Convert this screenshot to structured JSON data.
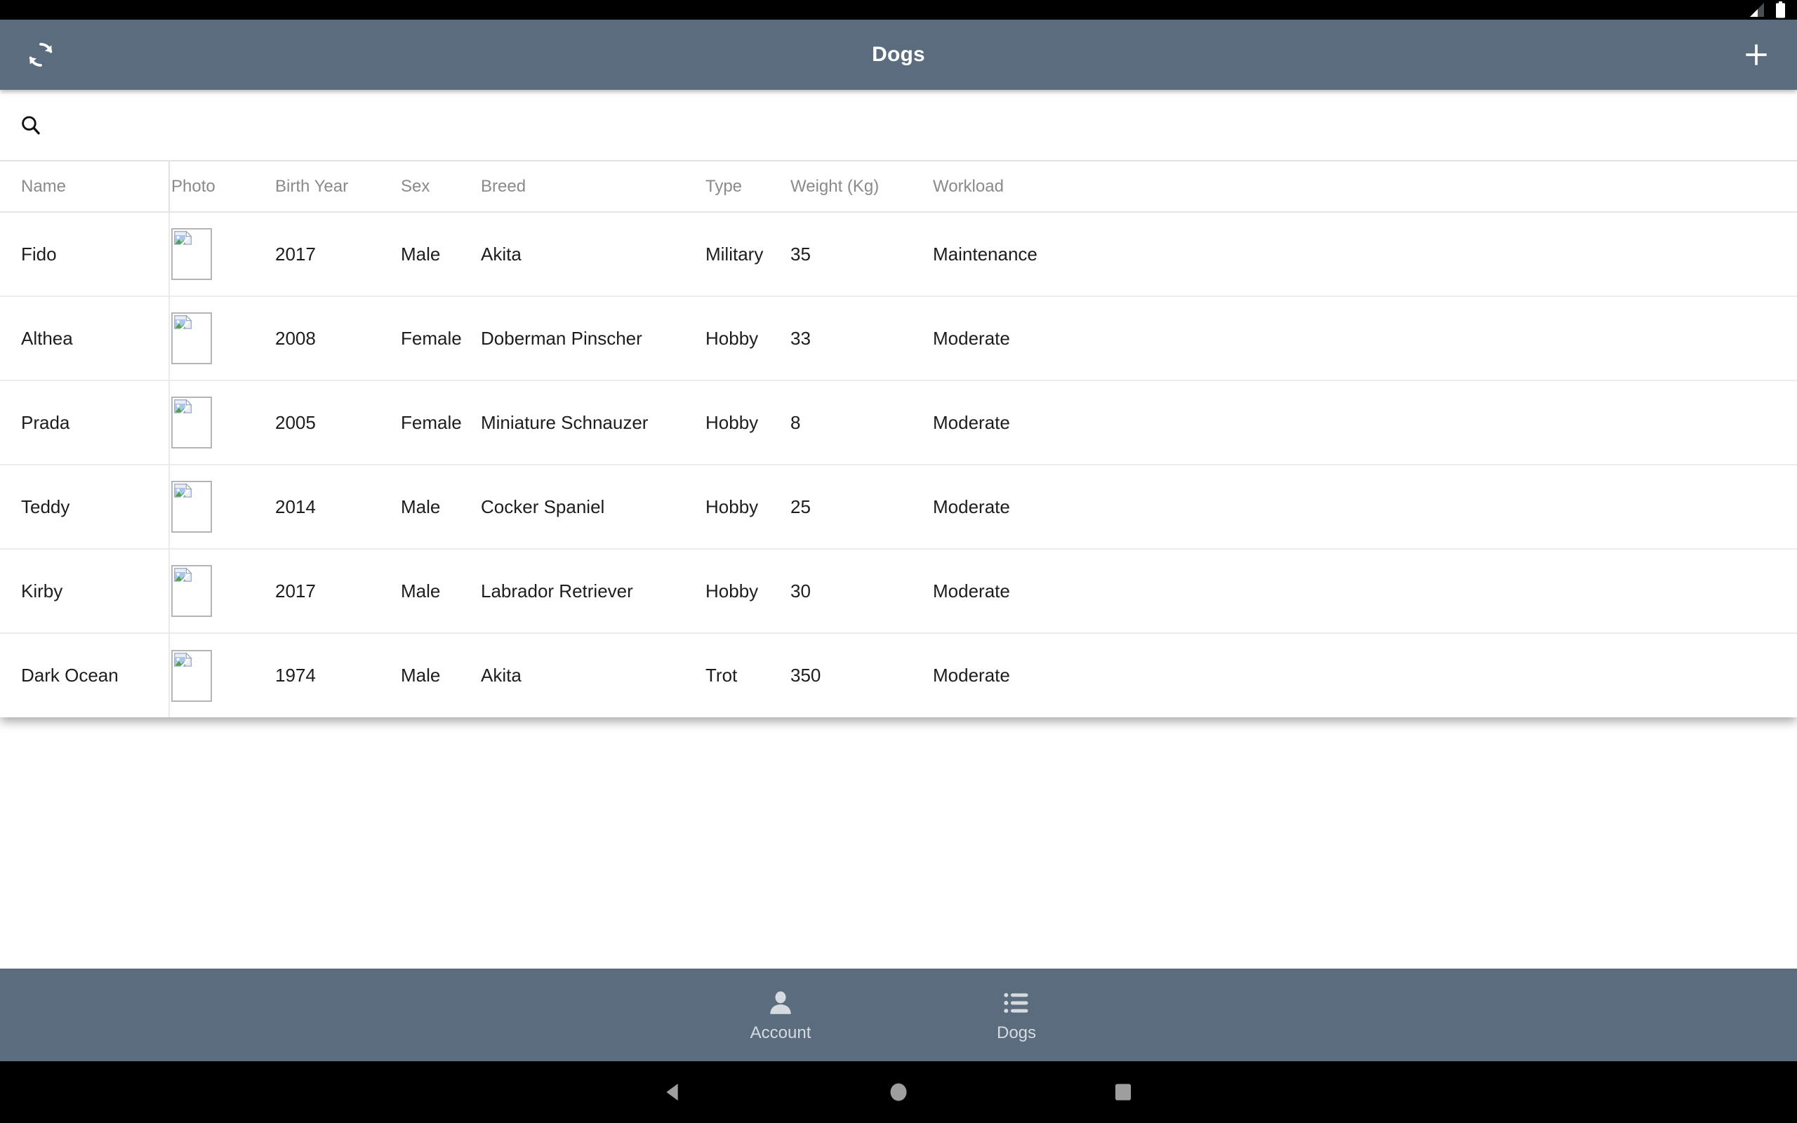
{
  "status_bar": {
    "signal_icon": "cell-signal-icon",
    "battery_icon": "battery-icon"
  },
  "app_bar": {
    "title": "Dogs",
    "refresh_icon": "refresh-icon",
    "add_icon": "plus-icon",
    "background_color": "#5b6c7e"
  },
  "search": {
    "icon": "search-icon",
    "value": "",
    "placeholder": ""
  },
  "table": {
    "columns": [
      {
        "key": "name",
        "label": "Name"
      },
      {
        "key": "photo",
        "label": "Photo"
      },
      {
        "key": "birth",
        "label": "Birth Year"
      },
      {
        "key": "sex",
        "label": "Sex"
      },
      {
        "key": "breed",
        "label": "Breed"
      },
      {
        "key": "type",
        "label": "Type"
      },
      {
        "key": "weight",
        "label": "Weight (Kg)"
      },
      {
        "key": "workload",
        "label": "Workload"
      }
    ],
    "photo_placeholder_icon": "broken-image-icon",
    "rows": [
      {
        "name": "Fido",
        "birth": "2017",
        "sex": "Male",
        "breed": "Akita",
        "type": "Military",
        "weight": "35",
        "workload": "Maintenance"
      },
      {
        "name": "Althea",
        "birth": "2008",
        "sex": "Female",
        "breed": "Doberman Pinscher",
        "type": "Hobby",
        "weight": "33",
        "workload": "Moderate"
      },
      {
        "name": "Prada",
        "birth": "2005",
        "sex": "Female",
        "breed": "Miniature Schnauzer",
        "type": "Hobby",
        "weight": "8",
        "workload": "Moderate"
      },
      {
        "name": "Teddy",
        "birth": "2014",
        "sex": "Male",
        "breed": "Cocker Spaniel",
        "type": "Hobby",
        "weight": "25",
        "workload": "Moderate"
      },
      {
        "name": "Kirby",
        "birth": "2017",
        "sex": "Male",
        "breed": "Labrador Retriever",
        "type": "Hobby",
        "weight": "30",
        "workload": "Moderate"
      },
      {
        "name": "Dark Ocean",
        "birth": "1974",
        "sex": "Male",
        "breed": "Akita",
        "type": "Trot",
        "weight": "350",
        "workload": "Moderate"
      }
    ]
  },
  "bottom_nav": {
    "tabs": [
      {
        "label": "Account",
        "icon": "person-icon",
        "selected": false
      },
      {
        "label": "Dogs",
        "icon": "list-icon",
        "selected": true
      }
    ]
  },
  "android_nav": {
    "back_icon": "triangle-back-icon",
    "home_icon": "circle-home-icon",
    "recents_icon": "square-recents-icon"
  }
}
